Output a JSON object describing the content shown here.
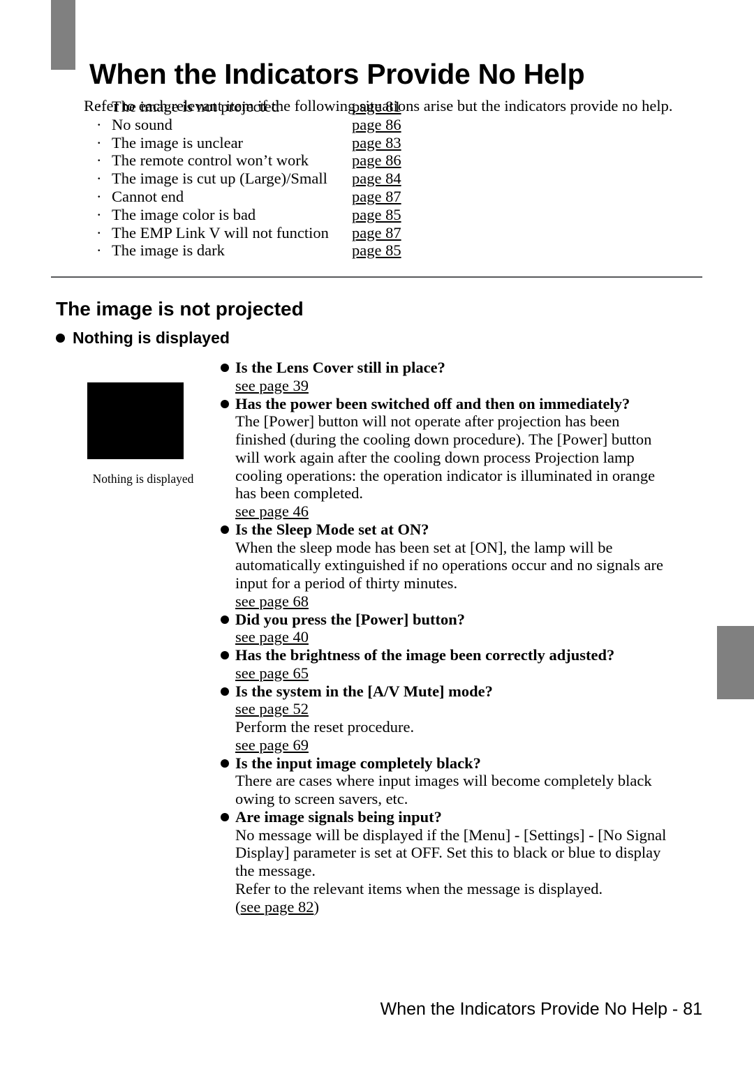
{
  "header": {
    "title": "When the Indicators Provide No Help",
    "intro": "Refer to each relevant item if the following situations arise but the indicators provide no help."
  },
  "index_list": [
    {
      "bullet": "·",
      "label": "The image is not projected",
      "page": "page 81"
    },
    {
      "bullet": "·",
      "label": "No sound",
      "page": "page 86"
    },
    {
      "bullet": "·",
      "label": "The image is unclear",
      "page": "page 83"
    },
    {
      "bullet": "·",
      "label": "The remote control won’t work",
      "page": "page 86"
    },
    {
      "bullet": "·",
      "label": "The image is cut up (Large)/Small",
      "page": "page 84"
    },
    {
      "bullet": "·",
      "label": "Cannot end",
      "page": "page 87"
    },
    {
      "bullet": "·",
      "label": "The image color is bad",
      "page": "page 85"
    },
    {
      "bullet": "·",
      "label": "The EMP Link V will not function",
      "page": "page 87"
    },
    {
      "bullet": "·",
      "label": "The image is dark",
      "page": "page 85"
    }
  ],
  "section": {
    "title": "The image is not projected",
    "subsection": "Nothing is displayed"
  },
  "figure": {
    "caption": "Nothing is displayed",
    "fill_color": "#000000"
  },
  "qa_lines": [
    {
      "kind": "question",
      "text": "Is the Lens Cover still in place?"
    },
    {
      "kind": "ref",
      "text": "see page 39"
    },
    {
      "kind": "question",
      "text": "Has the power been switched off and then on immediately?"
    },
    {
      "kind": "body",
      "text": "The [Power] button will not operate after projection has been"
    },
    {
      "kind": "body",
      "text": "finished (during the cooling down procedure). The [Power] button"
    },
    {
      "kind": "body",
      "text": "will work again after the cooling down process Projection lamp"
    },
    {
      "kind": "body",
      "text": "cooling operations: the operation indicator is illuminated in orange"
    },
    {
      "kind": "body",
      "text": "has been completed."
    },
    {
      "kind": "ref",
      "text": "see page 46"
    },
    {
      "kind": "question",
      "text": "Is the Sleep Mode set at ON?"
    },
    {
      "kind": "body",
      "text": "When the sleep mode has been set at [ON], the lamp will be"
    },
    {
      "kind": "body",
      "text": "automatically extinguished if no operations occur and no signals are"
    },
    {
      "kind": "body",
      "text": "input for a period of thirty minutes."
    },
    {
      "kind": "ref",
      "text": "see page 68"
    },
    {
      "kind": "question",
      "text": "Did you press the [Power] button?"
    },
    {
      "kind": "ref",
      "text": "see page 40"
    },
    {
      "kind": "question",
      "text": "Has the brightness of the image been correctly adjusted?"
    },
    {
      "kind": "ref",
      "text": "see page 65"
    },
    {
      "kind": "question",
      "text": "Is the system in the [A/V Mute] mode?"
    },
    {
      "kind": "ref",
      "text": "see page 52"
    },
    {
      "kind": "body",
      "text": "Perform the reset procedure."
    },
    {
      "kind": "ref",
      "text": "see page 69"
    },
    {
      "kind": "question",
      "text": "Is the input image completely black?"
    },
    {
      "kind": "body",
      "text": "There are cases where input images will become completely black"
    },
    {
      "kind": "body",
      "text": "owing to screen savers, etc."
    },
    {
      "kind": "question",
      "text": "Are image signals being input?"
    },
    {
      "kind": "body",
      "text": "No message will be displayed if the [Menu] - [Settings] - [No Signal"
    },
    {
      "kind": "body",
      "text": "Display] parameter is set at OFF. Set this to black or blue to display"
    },
    {
      "kind": "body",
      "text": "the message."
    },
    {
      "kind": "body",
      "text": "Refer to the relevant items when the message is displayed."
    },
    {
      "kind": "ref-paren",
      "prefix": "(",
      "text": "see page 82",
      "suffix": ")"
    }
  ],
  "footer": {
    "text": "When the Indicators Provide No Help - 81"
  },
  "colors": {
    "accent_gray": "#808080",
    "rule_gray": "#58595b"
  }
}
